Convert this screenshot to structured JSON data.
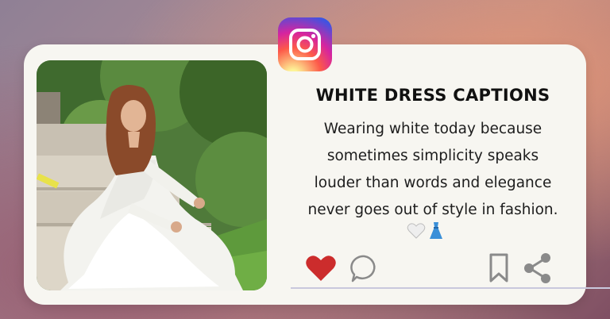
{
  "post": {
    "title": "WHITE DRESS CAPTIONS",
    "caption_lines": [
      "Wearing white today because",
      "sometimes simplicity speaks",
      "louder than words and elegance",
      "never goes out of style in fashion."
    ],
    "emojis": [
      "white-heart",
      "blue-dress"
    ]
  },
  "icons": {
    "logo": "instagram-icon",
    "like": "heart-icon",
    "comment": "comment-icon",
    "save": "bookmark-icon",
    "share": "share-icon"
  },
  "colors": {
    "like_red": "#cc2c2c",
    "icon_gray": "#8a8a8a",
    "card_bg": "#f7f6f1",
    "divider": "#c9c8dd"
  }
}
